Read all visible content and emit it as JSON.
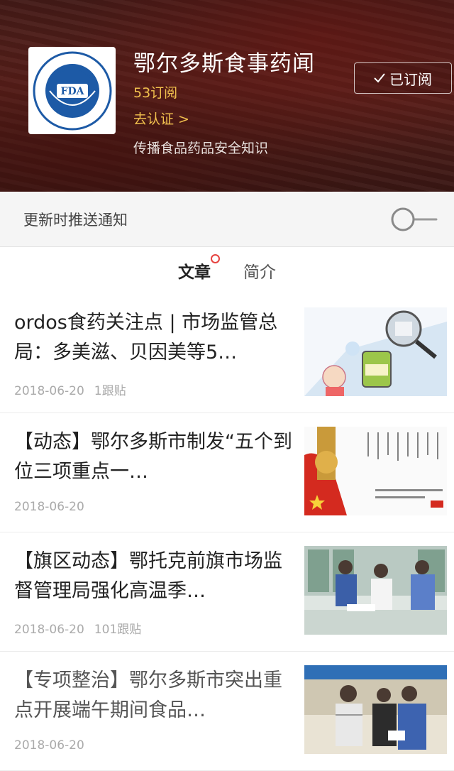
{
  "account": {
    "name": "鄂尔多斯食事药闻",
    "subscribers": "53订阅",
    "verify_link": "去认证 >",
    "description": "传播食品药品安全知识",
    "subscribed_label": "已订阅",
    "logo_text": "FDA"
  },
  "notify": {
    "label": "更新时推送通知",
    "enabled": false
  },
  "tabs": [
    {
      "label": "文章",
      "active": true,
      "has_dot": true
    },
    {
      "label": "简介",
      "active": false
    }
  ],
  "articles": [
    {
      "title": "ordos食药关注点 | 市场监管总局：多美滋、贝因美等5…",
      "date": "2018-06-20",
      "comments": "1跟贴"
    },
    {
      "title": "【动态】鄂尔多斯市制发“五个到位三项重点一…",
      "date": "2018-06-20",
      "comments": ""
    },
    {
      "title": "【旗区动态】鄂托克前旗市场监督管理局强化高温季…",
      "date": "2018-06-20",
      "comments": "101跟贴"
    },
    {
      "title": "【专项整治】鄂尔多斯市突出重点开展端午期间食品…",
      "date": "2018-06-20",
      "comments": ""
    }
  ],
  "colors": {
    "accent": "#f2c14e",
    "dot": "#e64340"
  }
}
